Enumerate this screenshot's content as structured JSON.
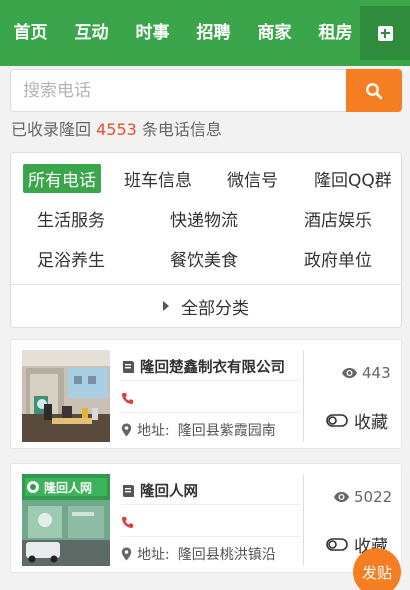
{
  "nav": {
    "items": [
      "首页",
      "互动",
      "时事",
      "招聘",
      "商家",
      "租房"
    ]
  },
  "search": {
    "placeholder": "搜索电话"
  },
  "summary": {
    "prefix": "已收录隆回",
    "count": "4553",
    "suffix": "条电话信息"
  },
  "categories": {
    "items": [
      "所有电话",
      "班车信息",
      "微信号",
      "隆回QQ群",
      "生活服务",
      "快递物流",
      "酒店娱乐",
      "足浴养生",
      "餐饮美食",
      "政府单位"
    ],
    "all_label": "全部分类"
  },
  "listings": [
    {
      "name": "隆回楚鑫制衣有限公司",
      "address_label": "地址:",
      "address": "隆回县紫霞园南",
      "views": "443",
      "fav_label": "收藏"
    },
    {
      "name": "隆回人网",
      "address_label": "地址:",
      "address": "隆回县桃洪镇沿",
      "views": "5022",
      "fav_label": "收藏",
      "sign_text": "隆回人网"
    }
  ],
  "post_button": "发贴",
  "colors": {
    "brand_green": "#3aa54a",
    "accent_orange": "#f57d22",
    "count_red": "#e8512f"
  }
}
